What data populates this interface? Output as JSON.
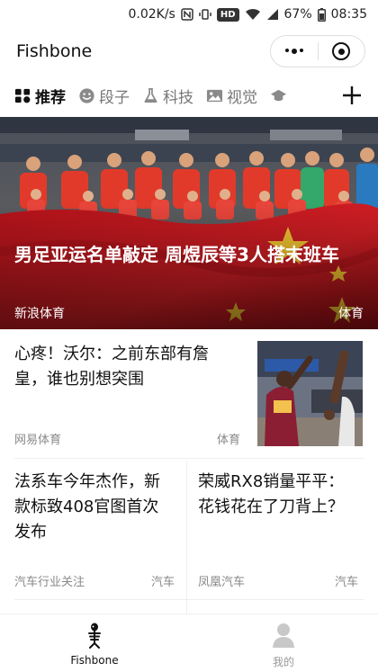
{
  "status_bar": {
    "speed": "0.02K/s",
    "hd_badge": "HD",
    "battery": "67%",
    "time": "08:35"
  },
  "title_bar": {
    "title": "Fishbone"
  },
  "tabs": [
    {
      "label": "推荐",
      "icon": "grid-icon",
      "active": true
    },
    {
      "label": "段子",
      "icon": "smiley-icon",
      "active": false
    },
    {
      "label": "科技",
      "icon": "flask-icon",
      "active": false
    },
    {
      "label": "视觉",
      "icon": "image-icon",
      "active": false
    }
  ],
  "hero": {
    "title": "男足亚运名单敲定 周煜辰等3人搭末班车",
    "source": "新浪体育",
    "category": "体育"
  },
  "news_list": [
    {
      "title": "心疼！沃尔：之前东部有詹皇，谁也别想突围",
      "source": "网易体育",
      "category": "体育"
    }
  ],
  "news_grid": [
    {
      "title": "法系车今年杰作，新款标致408官图首次发布",
      "source": "汽车行业关注",
      "category": "汽车"
    },
    {
      "title": "荣威RX8销量平平：花钱花在了刀背上？",
      "source": "凤凰汽车",
      "category": "汽车"
    }
  ],
  "bottom_nav": [
    {
      "label": "Fishbone",
      "icon": "fishbone-icon",
      "active": true
    },
    {
      "label": "我的",
      "icon": "person-icon",
      "active": false
    }
  ],
  "colors": {
    "flag_red": "#c8161d",
    "jersey_red": "#e23a2a",
    "muted_text": "#888888"
  }
}
